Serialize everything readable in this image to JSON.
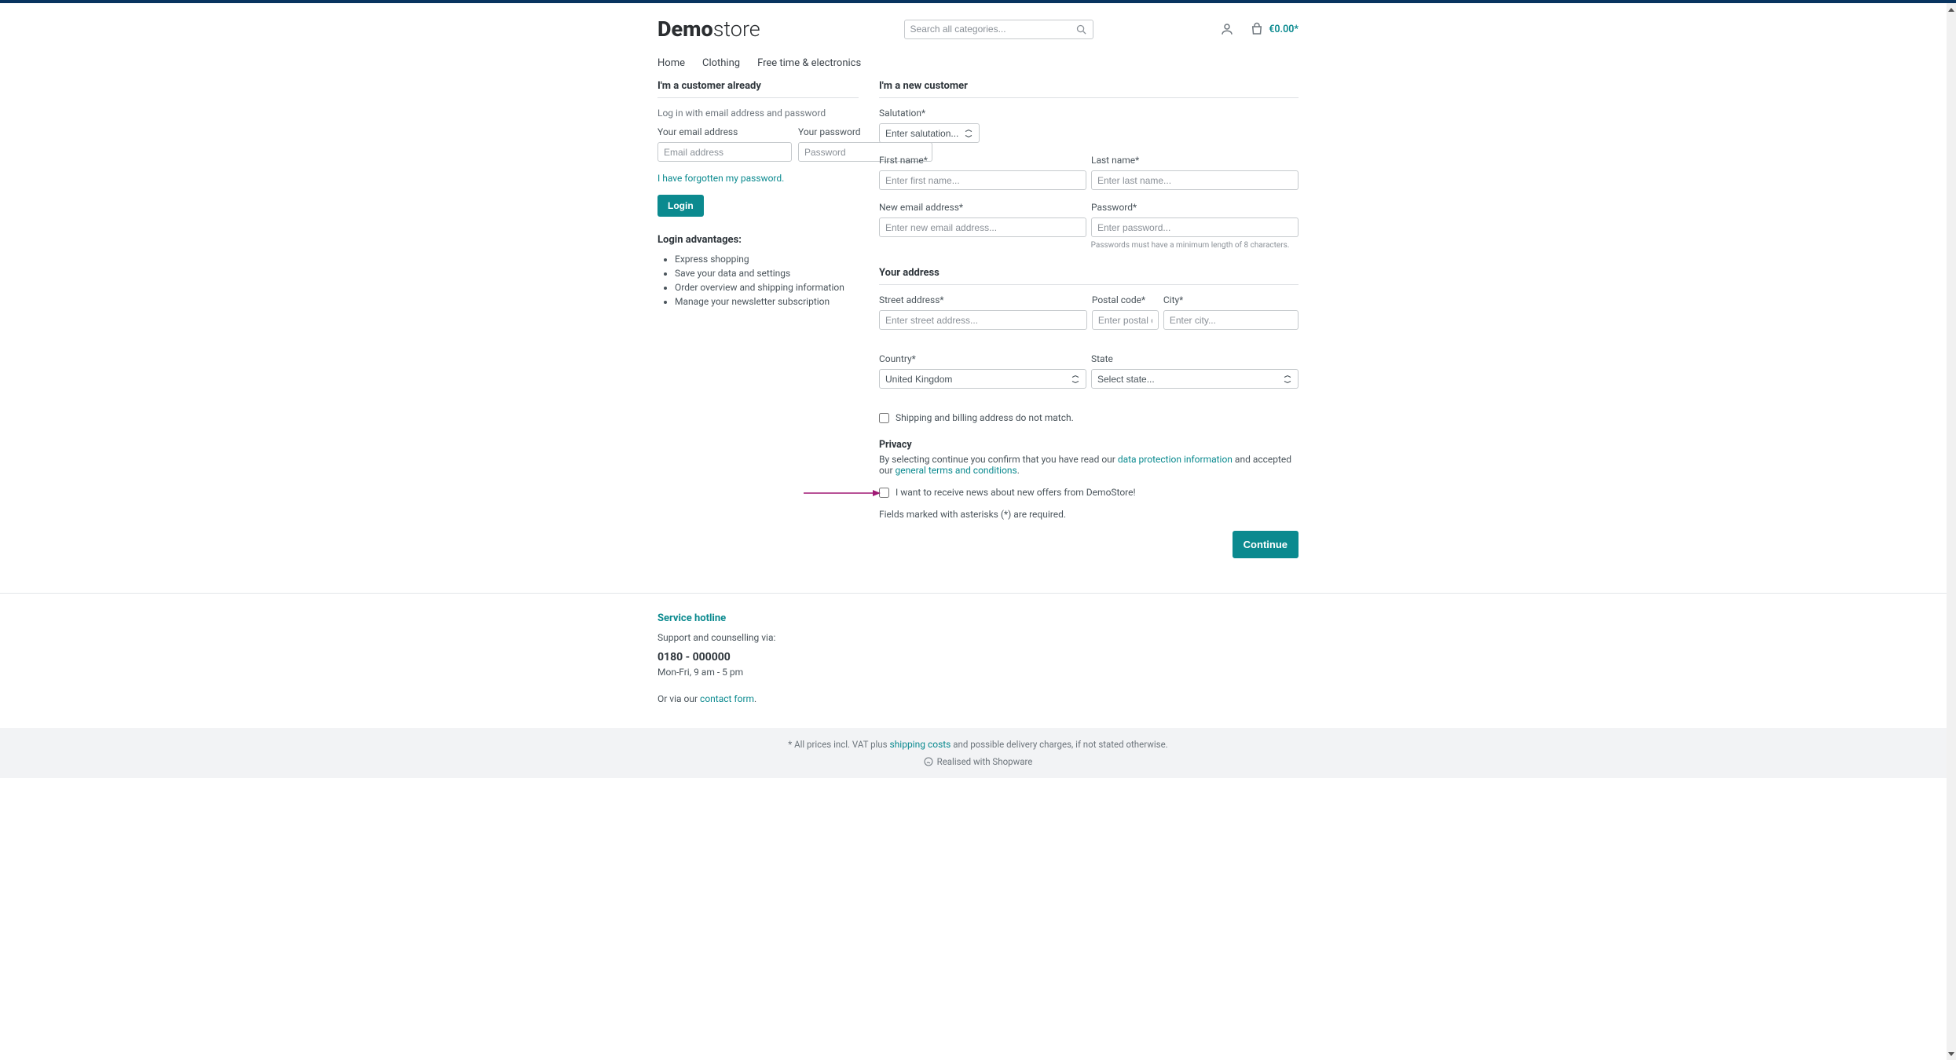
{
  "header": {
    "logo_bold": "Demo",
    "logo_light": "store",
    "search_placeholder": "Search all categories...",
    "cart_total": "€0.00*"
  },
  "nav": {
    "home": "Home",
    "clothing": "Clothing",
    "freetime": "Free time & electronics"
  },
  "login": {
    "heading": "I'm a customer already",
    "instruction": "Log in with email address and password",
    "email_label": "Your email address",
    "email_placeholder": "Email address",
    "password_label": "Your password",
    "password_placeholder": "Password",
    "forgot_link": "I have forgotten my password.",
    "login_button": "Login",
    "advantages_heading": "Login advantages:",
    "adv1": "Express shopping",
    "adv2": "Save your data and settings",
    "adv3": "Order overview and shipping information",
    "adv4": "Manage your newsletter subscription"
  },
  "register": {
    "heading": "I'm a new customer",
    "salutation_label": "Salutation*",
    "salutation_placeholder": "Enter salutation...",
    "firstname_label": "First name*",
    "firstname_placeholder": "Enter first name...",
    "lastname_label": "Last name*",
    "lastname_placeholder": "Enter last name...",
    "email_label": "New email address*",
    "email_placeholder": "Enter new email address...",
    "password_label": "Password*",
    "password_placeholder": "Enter password...",
    "password_hint": "Passwords must have a minimum length of 8 characters.",
    "address_heading": "Your address",
    "street_label": "Street address*",
    "street_placeholder": "Enter street address...",
    "postal_label": "Postal code*",
    "postal_placeholder": "Enter postal code.",
    "city_label": "City*",
    "city_placeholder": "Enter city...",
    "country_label": "Country*",
    "country_value": "United Kingdom",
    "state_label": "State",
    "state_placeholder": "Select state...",
    "shipping_diff": "Shipping and billing address do not match.",
    "privacy_heading": "Privacy",
    "privacy_text_1": "By selecting continue you confirm that you have read our ",
    "privacy_link_1": "data protection information",
    "privacy_text_2": " and accepted our ",
    "privacy_link_2": "general terms and conditions",
    "privacy_text_3": ".",
    "newsletter_check": "I want to receive news about new offers from DemoStore!",
    "required_note": "Fields marked with asterisks (*) are required.",
    "continue_button": "Continue"
  },
  "footer": {
    "hotline_heading": "Service hotline",
    "support_text": "Support and counselling via:",
    "phone": "0180 - 000000",
    "hours": "Mon-Fri, 9 am - 5 pm",
    "orvia": "Or via our ",
    "contact_link": "contact form",
    "orvia_end": ".",
    "prices_note_1": "* All prices incl. VAT plus ",
    "shipping_link": "shipping costs",
    "prices_note_2": " and possible delivery charges, if not stated otherwise.",
    "realised": "Realised with Shopware"
  }
}
